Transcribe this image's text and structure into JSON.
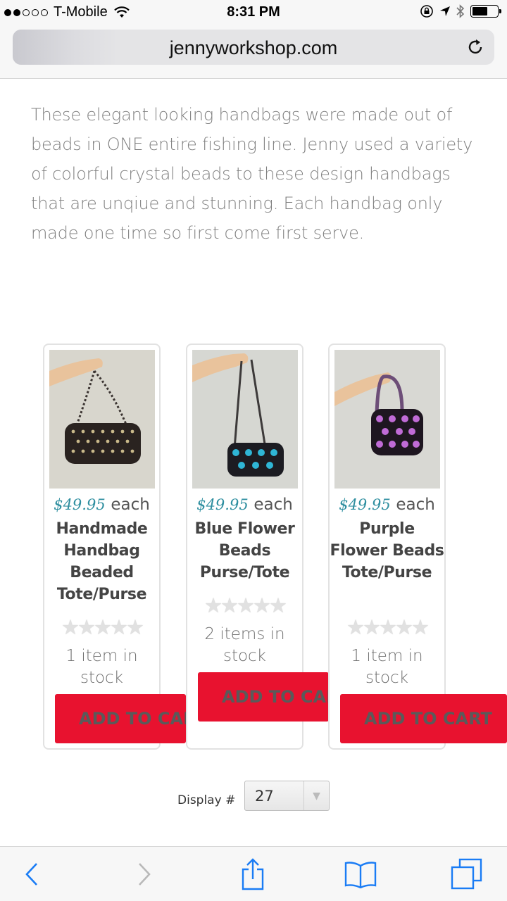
{
  "status_bar": {
    "carrier": "T-Mobile",
    "time": "8:31 PM",
    "signal_bars_filled": 2,
    "signal_bars_total": 5,
    "icons": [
      "wifi-icon",
      "rotation-lock-icon",
      "location-arrow-icon",
      "bluetooth-icon",
      "battery-icon"
    ]
  },
  "browser": {
    "url": "jennyworkshop.com",
    "reload_icon": "reload-icon"
  },
  "description": "These elegant looking handbags were made out of beads in ONE entire fishing line. Jenny used a variety of colorful crystal beads to these design handbags that are unqiue and stunning. Each handbag only made one time so first come first serve.",
  "products": [
    {
      "price": "$49.95",
      "each": "each",
      "name": "Handmade Handbag Beaded Tote/Purse",
      "stock": "1 item in stock",
      "button": "ADD TO CART",
      "stars": "★★★★★",
      "colors": {
        "bag": "#2a2320",
        "accent": "#c9b98a"
      }
    },
    {
      "price": "$49.95",
      "each": "each",
      "name": "Blue Flower Beads Purse/Tote",
      "stock": "2 items in stock",
      "button": "ADD TO CART",
      "stars": "★★★★★",
      "colors": {
        "bag": "#1c1c22",
        "accent": "#2fb6d6"
      }
    },
    {
      "price": "$49.95",
      "each": "each",
      "name": "Purple Flower Beads Tote/Purse",
      "stock": "1 item in stock",
      "button": "ADD TO CART",
      "stars": "★★★★★",
      "colors": {
        "bag": "#1e1620",
        "accent": "#c06bd6"
      }
    }
  ],
  "display": {
    "label": "Display #",
    "value": "27"
  },
  "toolbar": {
    "buttons": [
      "back-icon",
      "forward-icon",
      "share-icon",
      "bookmarks-icon",
      "tabs-icon"
    ]
  },
  "colors": {
    "accent_blue": "#2f8fa0",
    "button_red": "#e8122f",
    "ios_blue": "#1a7cf5"
  }
}
